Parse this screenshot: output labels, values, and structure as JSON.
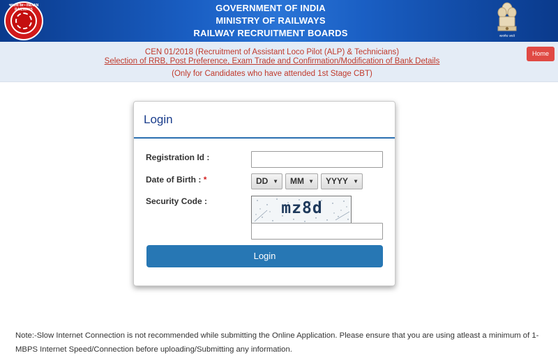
{
  "header": {
    "line1": "GOVERNMENT OF INDIA",
    "line2": "MINISTRY OF RAILWAYS",
    "line3": "RAILWAY RECRUITMENT BOARDS",
    "logo_text": "भारतीय रेल • INDIAN RAILWAYS",
    "emblem_caption": "सत्यमेव जयते"
  },
  "subheader": {
    "line1": "CEN 01/2018 (Recruitment of Assistant Loco Pilot (ALP) & Technicians)",
    "line2": "Selection of RRB, Post Preference, Exam Trade and Confirmation/Modification of Bank Details",
    "line3": "(Only for Candidates who have attended 1st Stage CBT)",
    "home_label": "Home"
  },
  "login_panel": {
    "title": "Login",
    "registration_label": "Registration Id :",
    "registration_value": "",
    "dob_label": "Date of Birth :",
    "dob_required": "*",
    "dob_day": "DD",
    "dob_month": "MM",
    "dob_year": "YYYY",
    "security_label": "Security Code :",
    "captcha_code": "mz8d",
    "security_value": "",
    "login_button": "Login"
  },
  "note": "Note:-Slow Internet Connection is not recommended while submitting the Online Application. Please ensure that you are using atleast a minimum of 1-MBPS Internet Speed/Connection before uploading/Submitting any information.",
  "colors": {
    "header_blue": "#1a5fc4",
    "accent_red": "#c0392b",
    "button_blue": "#2777b4",
    "home_red": "#e04a44"
  }
}
